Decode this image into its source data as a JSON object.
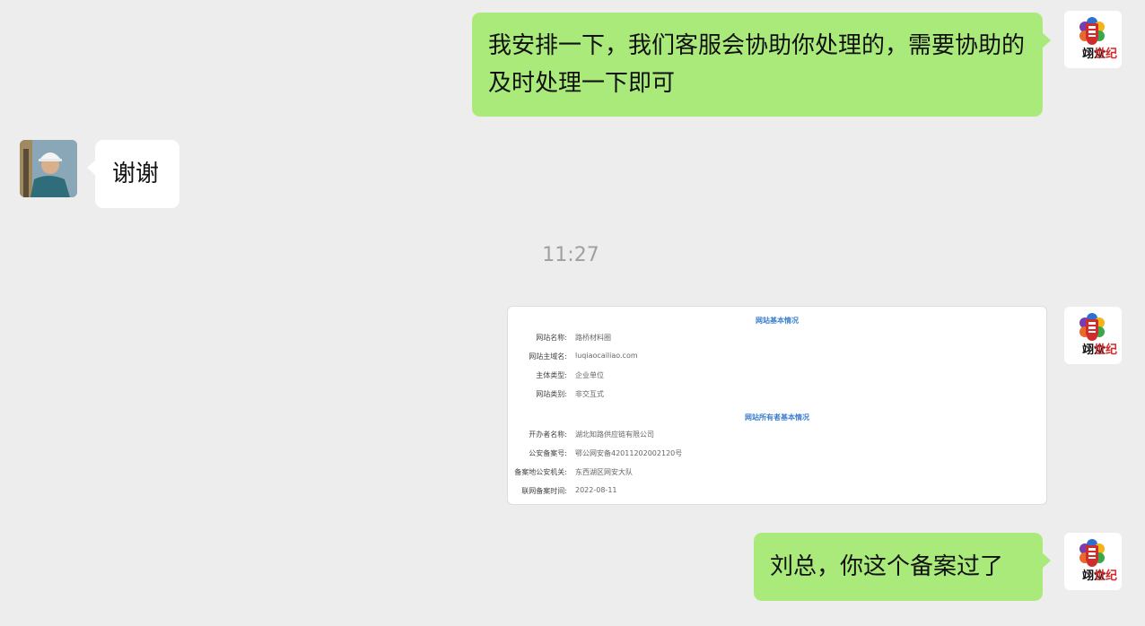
{
  "messages": {
    "m1": {
      "text": "我安排一下，我们客服会协助你处理的，需要协助的及时处理一下即可"
    },
    "m2": {
      "text": "谢谢"
    },
    "timestamp": "11:27",
    "m4": {
      "text": "刘总，你这个备案过了"
    }
  },
  "brand": {
    "logo_text": "翊众世纪",
    "logo_text_dark": "翊众",
    "logo_text_red": "世纪"
  },
  "record_image": {
    "section1_title": "网站基本情况",
    "section1_rows": [
      {
        "label": "网站名称:",
        "value": "路桥材料圈"
      },
      {
        "label": "网站主域名:",
        "value": "luqiaocailiao.com"
      },
      {
        "label": "主体类型:",
        "value": "企业单位"
      },
      {
        "label": "网站类别:",
        "value": "非交互式"
      }
    ],
    "section2_title": "网站所有者基本情况",
    "section2_rows": [
      {
        "label": "开办者名称:",
        "value": "湖北知路供应链有限公司"
      },
      {
        "label": "公安备案号:",
        "value": "鄂公网安备42011202002120号"
      },
      {
        "label": "备案地公安机关:",
        "value": "东西湖区网安大队"
      },
      {
        "label": "联网备案时间:",
        "value": "2022-08-11"
      }
    ]
  },
  "colors": {
    "background": "#ededed",
    "outgoing_bubble": "#a9ea7a",
    "incoming_bubble": "#ffffff",
    "brand_red": "#d22b2b",
    "link_blue": "#3b7ecf"
  }
}
